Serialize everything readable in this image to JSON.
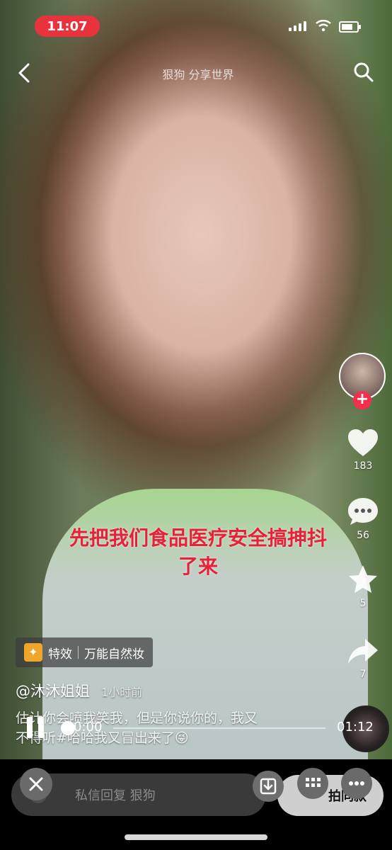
{
  "status_bar": {
    "time": "11:07"
  },
  "top_nav": {
    "title": "狠狗 分享世界"
  },
  "subtitle": {
    "line1": "先把我们食品医疗安全搞抻抖",
    "line2": "了来"
  },
  "side_actions": {
    "likes": "183",
    "comments": "56",
    "favorites": "5",
    "shares": "7"
  },
  "effect_tag": {
    "label": "特效",
    "name": "万能自然妆"
  },
  "author": {
    "name": "@沐沐姐姐",
    "time": "1小时前"
  },
  "caption": {
    "line1": "估计你会喷我笑我，但是你说你的，我又",
    "line2": "不得听#哈哈我又冒出来了😜"
  },
  "player": {
    "current": "0:00",
    "total": "01:12",
    "progress": 0.0
  },
  "bottom_bar": {
    "dm_placeholder": "私信回复 狠狗",
    "shoot_label": "拍同款"
  },
  "colors": {
    "accent": "#f52f4b",
    "subtitle": "#e8213b",
    "time_pill": "#e8323d"
  }
}
